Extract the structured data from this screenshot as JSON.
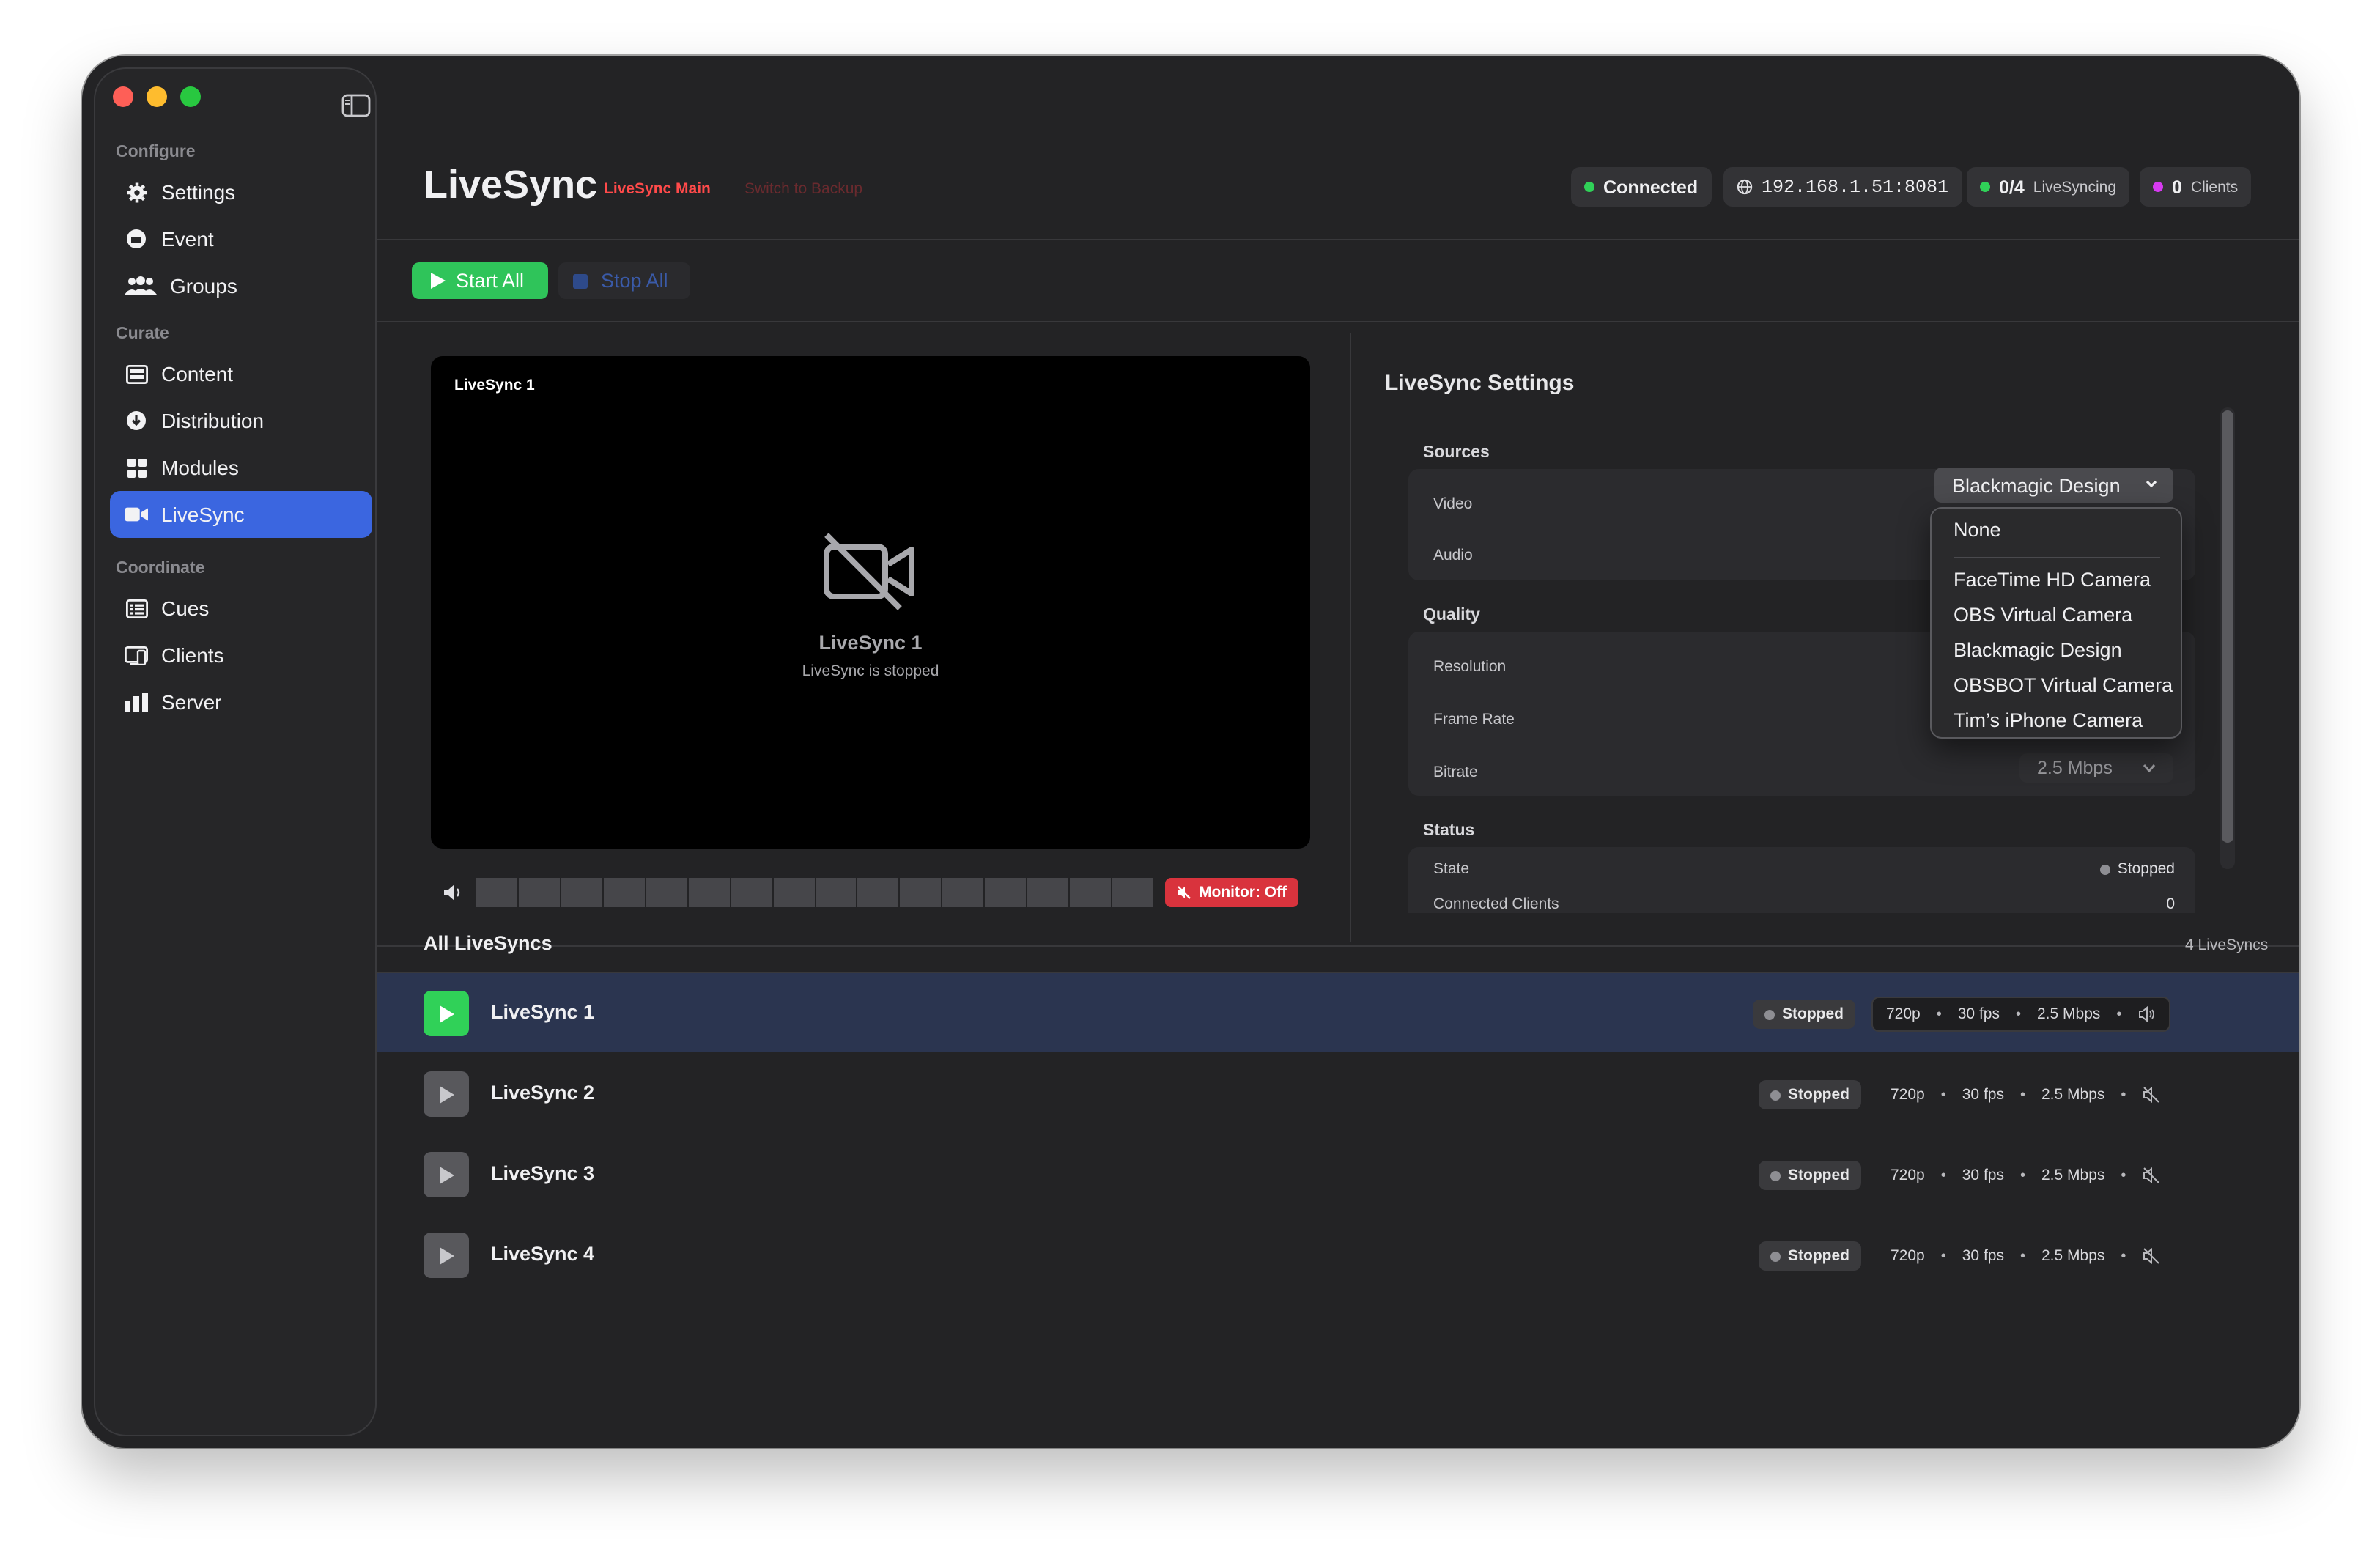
{
  "app": {
    "title": "LiveSync",
    "tag_main": "LiveSync Main",
    "tag_backup": "Switch to Backup"
  },
  "sidebar": {
    "sections": [
      {
        "label": "Configure",
        "items": [
          {
            "label": "Settings",
            "icon": "gear-icon"
          },
          {
            "label": "Event",
            "icon": "calendar-icon"
          },
          {
            "label": "Groups",
            "icon": "people-icon"
          }
        ]
      },
      {
        "label": "Curate",
        "items": [
          {
            "label": "Content",
            "icon": "film-icon"
          },
          {
            "label": "Distribution",
            "icon": "download-circle-icon"
          },
          {
            "label": "Modules",
            "icon": "grid-icon"
          },
          {
            "label": "LiveSync",
            "icon": "video-camera-icon",
            "active": true
          }
        ]
      },
      {
        "label": "Coordinate",
        "items": [
          {
            "label": "Cues",
            "icon": "list-icon"
          },
          {
            "label": "Clients",
            "icon": "monitor-icon"
          },
          {
            "label": "Server",
            "icon": "bars-icon"
          }
        ]
      }
    ]
  },
  "header": {
    "connected": "Connected",
    "address": "192.168.1.51:8081",
    "livesyncing_count": "0/4",
    "livesyncing_label": "LiveSyncing",
    "clients_count": "0",
    "clients_label": "Clients",
    "colors": {
      "green": "#30d158",
      "magenta": "#d63af0"
    }
  },
  "toolbar": {
    "start_all": "Start All",
    "stop_all": "Stop All"
  },
  "preview": {
    "label": "LiveSync 1",
    "name": "LiveSync 1",
    "status": "LiveSync is stopped",
    "monitor": "Monitor: Off"
  },
  "settings": {
    "title": "LiveSync Settings",
    "sources": {
      "label": "Sources",
      "video_label": "Video",
      "audio_label": "Audio",
      "video_value": "Blackmagic Design"
    },
    "quality": {
      "label": "Quality",
      "resolution_label": "Resolution",
      "frame_rate_label": "Frame Rate",
      "bitrate_label": "Bitrate",
      "bitrate_value": "2.5 Mbps"
    },
    "status": {
      "label": "Status",
      "state_label": "State",
      "state_value": "Stopped",
      "clients_label": "Connected Clients",
      "clients_value": "0"
    }
  },
  "dropdown": {
    "options": [
      "None",
      "FaceTime HD Camera",
      "OBS Virtual Camera",
      "Blackmagic Design",
      "OBSBOT Virtual Camera",
      "Tim’s iPhone Camera"
    ]
  },
  "list": {
    "title": "All LiveSyncs",
    "count": "4 LiveSyncs",
    "rows": [
      {
        "name": "LiveSync 1",
        "status": "Stopped",
        "resolution": "720p",
        "fps": "30 fps",
        "bitrate": "2.5 Mbps",
        "selected": true
      },
      {
        "name": "LiveSync 2",
        "status": "Stopped",
        "resolution": "720p",
        "fps": "30 fps",
        "bitrate": "2.5 Mbps"
      },
      {
        "name": "LiveSync 3",
        "status": "Stopped",
        "resolution": "720p",
        "fps": "30 fps",
        "bitrate": "2.5 Mbps"
      },
      {
        "name": "LiveSync 4",
        "status": "Stopped",
        "resolution": "720p",
        "fps": "30 fps",
        "bitrate": "2.5 Mbps"
      }
    ]
  }
}
